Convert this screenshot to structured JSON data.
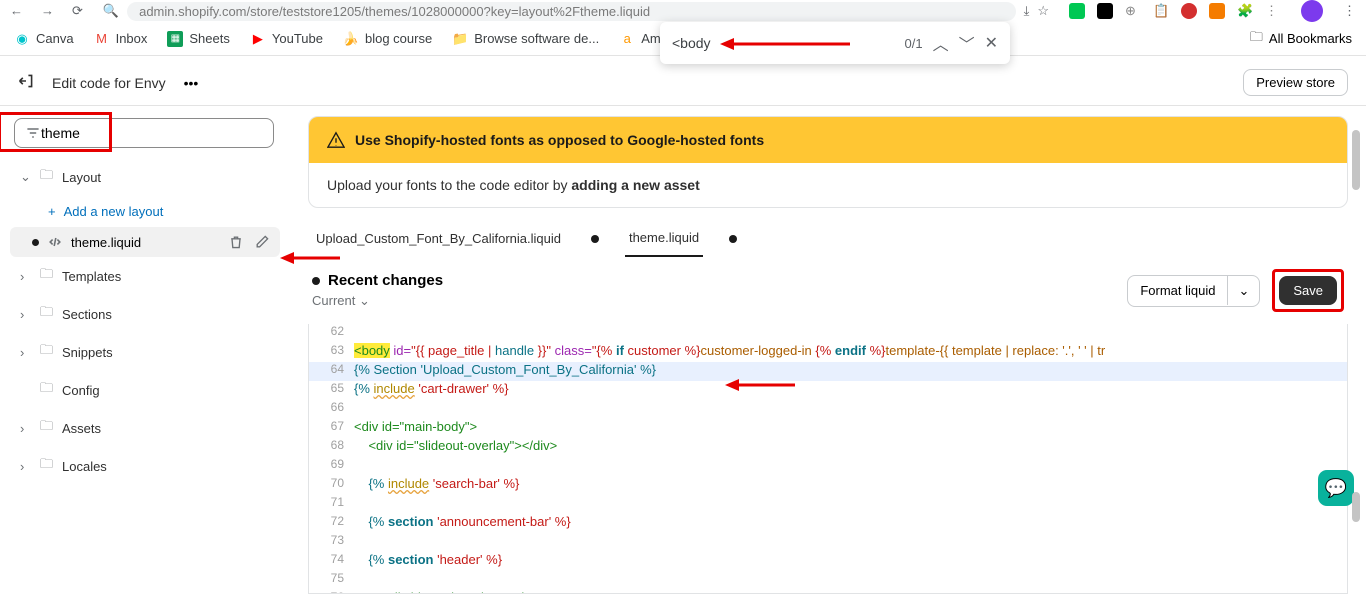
{
  "browser": {
    "url": "admin.shopify.com/store/teststore1205/themes/1028000000?key=layout%2Ftheme.liquid"
  },
  "bookmarks": {
    "items": [
      "Canva",
      "Inbox",
      "Sheets",
      "YouTube",
      "blog course",
      "Browse software de...",
      "Amazon.com:"
    ],
    "all": "All Bookmarks"
  },
  "find": {
    "value": "<body",
    "count": "0/1"
  },
  "header": {
    "title": "Edit code for Envy",
    "preview": "Preview store"
  },
  "search": {
    "value": "theme"
  },
  "sidebar": {
    "layout": "Layout",
    "add_layout": "Add a new layout",
    "file": "theme.liquid",
    "folders": [
      "Templates",
      "Sections",
      "Snippets",
      "Config",
      "Assets",
      "Locales"
    ]
  },
  "alert": {
    "title": "Use Shopify-hosted fonts as opposed to Google-hosted fonts",
    "body_a": "Upload your fonts to the code editor by ",
    "body_b": "adding a new asset"
  },
  "tabs": {
    "a": "Upload_Custom_Font_By_California.liquid",
    "b": "theme.liquid"
  },
  "changes": {
    "title": "Recent changes",
    "current": "Current",
    "format": "Format liquid",
    "save": "Save"
  },
  "code": {
    "lines": {
      "n62": "62",
      "n63": "63",
      "n64": "64",
      "n65": "65",
      "n66": "66",
      "n67": "67",
      "n68": "68",
      "n69": "69",
      "n70": "70",
      "n71": "71",
      "n72": "72",
      "n73": "73",
      "n74": "74",
      "n75": "75",
      "n76": "76"
    },
    "l63_a": "<body",
    "l63_b": " id=",
    "l63_c": "\"{{ page_title | ",
    "l63_c2": "handle",
    "l63_c3": " }}\"",
    "l63_d": " class=",
    "l63_e": "\"{% ",
    "l63_f": "if",
    "l63_g": " customer ",
    "l63_h": "%}",
    "l63_i": "customer-logged-in ",
    "l63_j": "{% ",
    "l63_k": "endif",
    "l63_l": " %}",
    "l63_m": "template-{{ template | replace: '.', ' ' | tr",
    "l64": "{% Section 'Upload_Custom_Font_By_California' %}",
    "l65_a": "{% ",
    "l65_b": "include",
    "l65_c": " 'cart-drawer' %}",
    "l67": "<div id=\"main-body\">",
    "l68": "    <div id=\"slideout-overlay\"></div>",
    "l70_a": "    {% ",
    "l70_b": "include",
    "l70_c": " 'search-bar' %}",
    "l72_a": "    {% ",
    "l72_b": "section",
    "l72_c": " 'announcement-bar' %}",
    "l74_a": "    {% ",
    "l74_b": "section",
    "l74_c": " 'header' %}",
    "l76": "        <div id=\"main\" role=\"main\">"
  }
}
